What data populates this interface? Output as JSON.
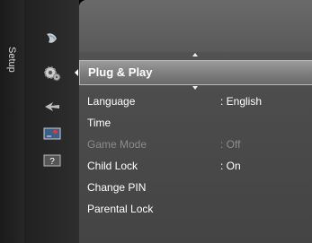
{
  "menu": {
    "category_label": "Setup",
    "selected_item": "Plug & Play",
    "items": [
      {
        "label": "Language",
        "value": ": English",
        "enabled": true
      },
      {
        "label": "Time",
        "value": "",
        "enabled": true
      },
      {
        "label": "Game Mode",
        "value": ": Off",
        "enabled": false
      },
      {
        "label": "Child Lock",
        "value": ": On",
        "enabled": true
      },
      {
        "label": "Change PIN",
        "value": "",
        "enabled": true
      },
      {
        "label": "Parental Lock",
        "value": "",
        "enabled": true
      }
    ]
  },
  "sidebar_icons": [
    "picture-icon",
    "setup-gear-icon",
    "input-icon",
    "application-icon",
    "support-help-icon"
  ],
  "support_icon_text": "?",
  "colors": {
    "selected_highlight": "#8a8a8a",
    "disabled_text": "#8c8c8c",
    "text": "#ffffff"
  }
}
